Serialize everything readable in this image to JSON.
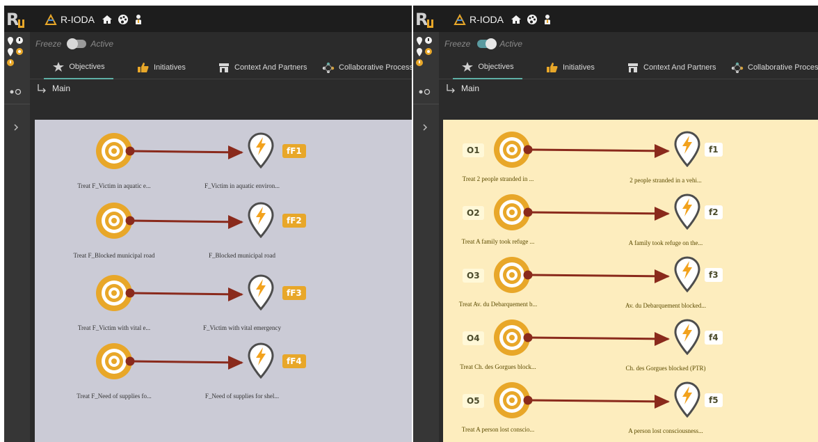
{
  "app": {
    "brand": "R-IODA"
  },
  "toolbar": {
    "freeze_label": "Freeze",
    "active_label": "Active"
  },
  "tabs": [
    {
      "label": "Objectives",
      "icon": "star-icon"
    },
    {
      "label": "Initiatives",
      "icon": "thumbs-up-icon"
    },
    {
      "label": "Context And Partners",
      "icon": "store-icon"
    },
    {
      "label": "Collaborative Process",
      "icon": "network-icon"
    }
  ],
  "breadcrumb": {
    "label": "Main"
  },
  "panes": [
    {
      "freeze_active": false,
      "canvas_color": "#cbcbd6",
      "rows": [
        {
          "objective": "Treat F_Victim in aquatic e...",
          "fact": "F_Victim in aquatic environ...",
          "fact_tag": "fF1",
          "obj_tag": ""
        },
        {
          "objective": "Treat F_Blocked municipal road",
          "fact": "F_Blocked municipal road",
          "fact_tag": "fF2",
          "obj_tag": ""
        },
        {
          "objective": "Treat F_Victim with vital e...",
          "fact": "F_Victim with vital emergency",
          "fact_tag": "fF3",
          "obj_tag": ""
        },
        {
          "objective": "Treat F_Need of supplies fo...",
          "fact": "F_Need of supplies for shel...",
          "fact_tag": "fF4",
          "obj_tag": ""
        }
      ]
    },
    {
      "freeze_active": true,
      "canvas_color": "#fdedbe",
      "rows": [
        {
          "objective": "Treat 2 people stranded in ...",
          "fact": "2 people stranded in a vehi...",
          "fact_tag": "f1",
          "obj_tag": "O1"
        },
        {
          "objective": "Treat A family took refuge ...",
          "fact": "A family took refuge on the...",
          "fact_tag": "f2",
          "obj_tag": "O2"
        },
        {
          "objective": "Treat Av. du Debarquement b...",
          "fact": "Av. du Debarquement blocked...",
          "fact_tag": "f3",
          "obj_tag": "O3"
        },
        {
          "objective": "Treat Ch. des Gorgues block...",
          "fact": "Ch. des Gorgues blocked (PTR)",
          "fact_tag": "f4",
          "obj_tag": "O4"
        },
        {
          "objective": "Treat A person lost conscio...",
          "fact": "A person lost consciousness...",
          "fact_tag": "f5",
          "obj_tag": "O5"
        }
      ]
    }
  ],
  "colors": {
    "topbar": "#1d1d1d",
    "panel": "#2b2b2b",
    "accent_tab": "#5fb0a6",
    "target_orange": "#e8a729",
    "link_red": "#8a2a1c"
  }
}
